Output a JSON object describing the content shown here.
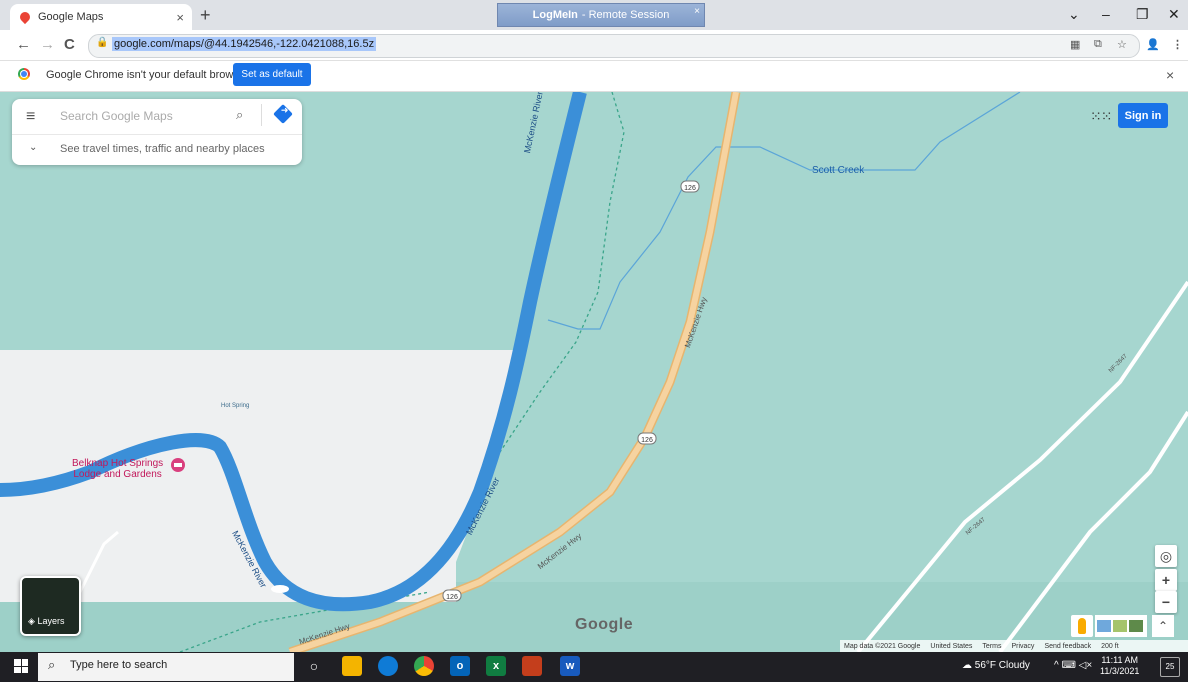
{
  "browser": {
    "tab_title": "Google Maps",
    "tab_close": "×",
    "new_tab": "+",
    "session_banner_app": "LogMeIn",
    "session_banner_text": "- Remote Session",
    "session_banner_close": "×",
    "window_controls": {
      "dropdown": "⌄",
      "minimize": "–",
      "restore": "❐",
      "close": "✕"
    },
    "nav": {
      "back": "←",
      "forward": "→",
      "reload": "C"
    },
    "url": "google.com/maps/@44.1942546,-122.0421088,16.5z",
    "lock_icon": "🔒",
    "omni_icons": {
      "qr": "▦",
      "share": "⧉",
      "star": "☆",
      "profile": "👤",
      "menu": "⋮"
    }
  },
  "infobar": {
    "message": "Google Chrome isn't your default browser",
    "button_label": "Set as default",
    "close": "×"
  },
  "search_panel": {
    "menu_icon": "≡",
    "placeholder": "Search Google Maps",
    "search_icon": "⌕",
    "expand_icon": "⌄",
    "travel_text": "See travel times, traffic and nearby places"
  },
  "top_right": {
    "apps_icon": "⁙⁙",
    "sign_in": "Sign in"
  },
  "map_labels": {
    "mckenzie_river_1": "McKenzie River",
    "mckenzie_river_2": "McKenzie River",
    "mckenzie_river_3": "McKenzie River",
    "mckenzie_hwy_1": "McKenzie Hwy",
    "mckenzie_hwy_2": "McKenzie Hwy",
    "mckenzie_hwy_3": "McKenzie Hwy",
    "scott_creek": "Scott Creek",
    "hot_spring": "Hot Spring",
    "belknap_line1": "Belknap Hot Springs",
    "belknap_line2": "Lodge and Gardens",
    "route_126": "126",
    "nf_2647": "NF-2647",
    "nf_2647_b": "NF-2647"
  },
  "map_controls": {
    "location_icon": "◎",
    "zoom_in": "+",
    "zoom_out": "−",
    "layers_label": "Layers",
    "layers_icon": "◈",
    "google_logo": "Google",
    "chevron_up": "⌃"
  },
  "footer": {
    "map_data": "Map data ©2021 Google",
    "region": "United States",
    "terms": "Terms",
    "privacy": "Privacy",
    "feedback": "Send feedback",
    "scale": "200 ft"
  },
  "taskbar": {
    "search_placeholder": "Type here to search",
    "search_icon": "⌕",
    "apps": {
      "cortana": "○",
      "outlook": "o",
      "excel": "x",
      "word": "w"
    },
    "weather": "56°F  Cloudy",
    "tray_icons": "^ ⌨ ◁×",
    "time": "11:11 AM",
    "date": "11/3/2021",
    "notifications": "25"
  },
  "colors": {
    "map_green": "#a6d6cf",
    "water": "#4a9edd",
    "highway": "#f2c98c",
    "chrome_blue": "#1a73e8",
    "poi_pink": "#d93f7e"
  }
}
